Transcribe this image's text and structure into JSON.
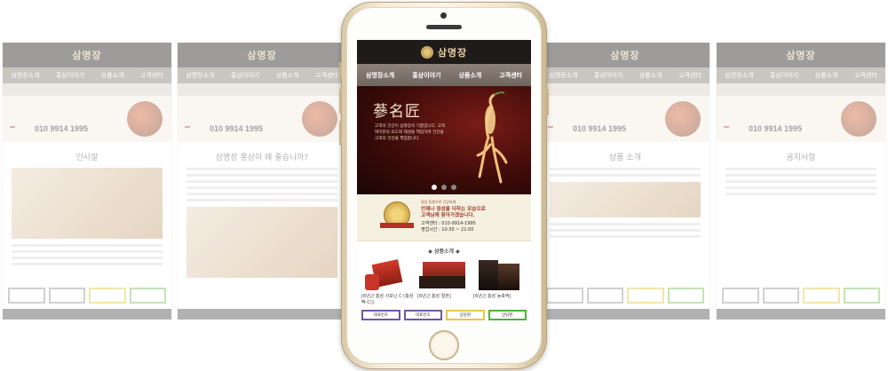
{
  "brand": {
    "logo": "삼명장"
  },
  "nav": [
    "삼명장소개",
    "홍삼이야기",
    "상품소개",
    "고객센터"
  ],
  "hero": {
    "title": "蔘名匠",
    "body": "고객의 건강이 삼명장의 기쁨입니다. 고객여러분의 효도와 재생을 책임하며 건강을 고객의 건강을 책임합니다.",
    "slides": 3,
    "active_slide": 1
  },
  "promo": {
    "small": "정성 동봉으로 건강하게",
    "line1": "언제나 정성을 다하는 모습으로",
    "line2": "고객님께 찾아가겠습니다.",
    "phone": "고객센터 : 010-9914-1995",
    "hours": "영업시간 : 10:30 ~ 21:00"
  },
  "products_section": {
    "title": "상품소개",
    "items": [
      {
        "name": "[6년근 홍삼 사포닌 C (홍삼팩-C)]"
      },
      {
        "name": "[6년근 홍삼 절편]"
      },
      {
        "name": "[6년근 홍삼 농축액]"
      }
    ]
  },
  "quick_links": [
    "대표번호",
    "대표번호",
    "상담원",
    "상담원"
  ],
  "background_pages": [
    {
      "logo": "삼명장",
      "nav": [
        "삼명장소개",
        "홍삼이야기",
        "상품소개",
        "고객센터"
      ],
      "phone": "010 9914 1995",
      "title": "인사말"
    },
    {
      "logo": "삼명장",
      "nav": [
        "삼명장소개",
        "홍삼이야기",
        "상품소개",
        "고객센터"
      ],
      "phone": "010 9914 1995",
      "title": "삼명장 홍삼이 왜 좋습니까?"
    },
    {
      "logo": "삼명장",
      "nav": [
        "삼명장소개",
        "홍삼이야기",
        "상품소개",
        "고객센터"
      ],
      "phone": "010 9914 1995",
      "title": "상품 소개"
    },
    {
      "logo": "삼명장",
      "nav": [
        "삼명장소개",
        "홍삼이야기",
        "상품소개",
        "고객센터"
      ],
      "phone": "010 9914 1995",
      "title": "공지사항"
    }
  ]
}
